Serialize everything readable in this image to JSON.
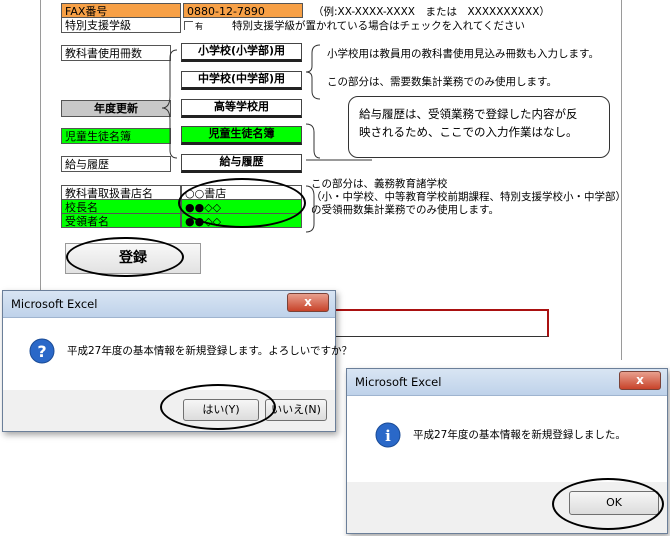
{
  "form": {
    "fax_label": "FAX番号",
    "fax_value": "0880-12-7890",
    "fax_example": "（例:XX-XXXX-XXXX　または　XXXXXXXXXX）",
    "special_label": "特別支援学級",
    "special_checkbox_label": "有",
    "special_note": "特別支援学級が置かれている場合はチェックを入れてください",
    "textbook_count_label": "教科書使用冊数",
    "btn_elementary": "小学校(小学部)用",
    "btn_junior": "中学校(中学部)用",
    "btn_high": "高等学校用",
    "year_update_label": "年度更新",
    "student_list_label": "児童生徒名簿",
    "btn_student_list": "児童生徒名簿",
    "salary_label": "給与履歴",
    "btn_salary": "給与履歴",
    "bookstore_label": "教科書取扱書店名",
    "bookstore_value": "○○書店",
    "principal_label": "校長名",
    "principal_value": "●●◇◇",
    "recipient_label": "受領者名",
    "recipient_value": "●●◇◇",
    "register_button": "登録"
  },
  "notes": {
    "note1": "小学校用は教員用の教科書使用見込み冊数も入力します。",
    "note2": "この部分は、需要数集計業務でのみ使用します。",
    "callout_line1": "給与履歴は、受領業務で登録した内容が反",
    "callout_line2": "映されるため、ここでの入力作業はなし。",
    "note3_line1": "この部分は、義務教育諸学校",
    "note3_line2": "（小・中学校、中等教育学校前期課程、特別支援学校小・中学部）",
    "note3_line3": "の受領冊数集計業務でのみ使用します。"
  },
  "dialog1": {
    "title": "Microsoft Excel",
    "close": "x",
    "icon": "question-icon",
    "message": "平成27年度の基本情報を新規登録します。よろしいですか？",
    "yes": "はい(Y)",
    "no": "いいえ(N)"
  },
  "dialog2": {
    "title": "Microsoft Excel",
    "close": "x",
    "icon": "info-icon",
    "message": "平成27年度の基本情報を新規登録しました。",
    "ok": "OK"
  }
}
